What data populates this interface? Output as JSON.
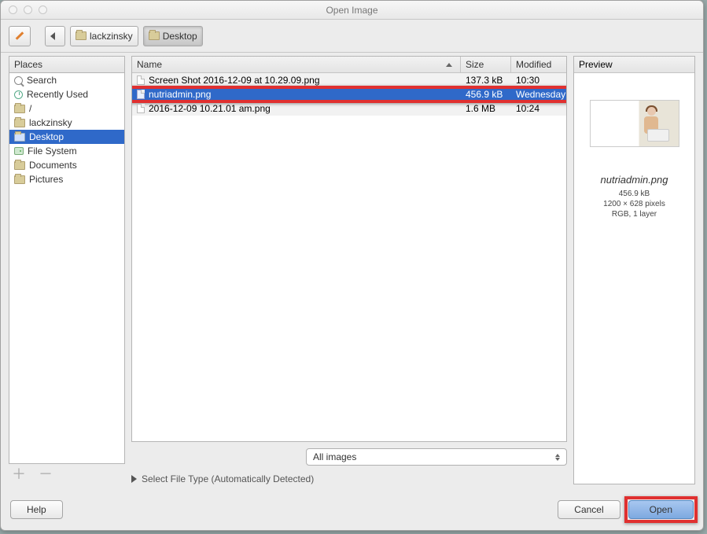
{
  "title": "Open Image",
  "path": {
    "parent": "lackzinsky",
    "current": "Desktop"
  },
  "sidebar": {
    "header": "Places",
    "items": [
      {
        "label": "Search",
        "icon": "search"
      },
      {
        "label": "Recently Used",
        "icon": "clock"
      },
      {
        "label": "/",
        "icon": "folder"
      },
      {
        "label": "lackzinsky",
        "icon": "folder"
      },
      {
        "label": "Desktop",
        "icon": "folder",
        "selected": true
      },
      {
        "label": "File System",
        "icon": "disk"
      },
      {
        "label": "Documents",
        "icon": "folder"
      },
      {
        "label": "Pictures",
        "icon": "folder"
      }
    ]
  },
  "columns": {
    "name": "Name",
    "size": "Size",
    "modified": "Modified"
  },
  "files": [
    {
      "name": "Screen Shot 2016-12-09 at 10.29.09.png",
      "size": "137.3 kB",
      "modified": "10:30",
      "selected": false
    },
    {
      "name": "nutriadmin.png",
      "size": "456.9 kB",
      "modified": "Wednesday",
      "selected": true
    },
    {
      "name": "2016-12-09 10.21.01 am.png",
      "size": "1.6 MB",
      "modified": "10:24",
      "selected": false
    }
  ],
  "filter": "All images",
  "filetype_line": "Select File Type (Automatically Detected)",
  "preview": {
    "header": "Preview",
    "name": "nutriadmin.png",
    "size": "456.9 kB",
    "dimensions": "1200 × 628 pixels",
    "mode": "RGB, 1 layer"
  },
  "buttons": {
    "help": "Help",
    "cancel": "Cancel",
    "open": "Open"
  }
}
